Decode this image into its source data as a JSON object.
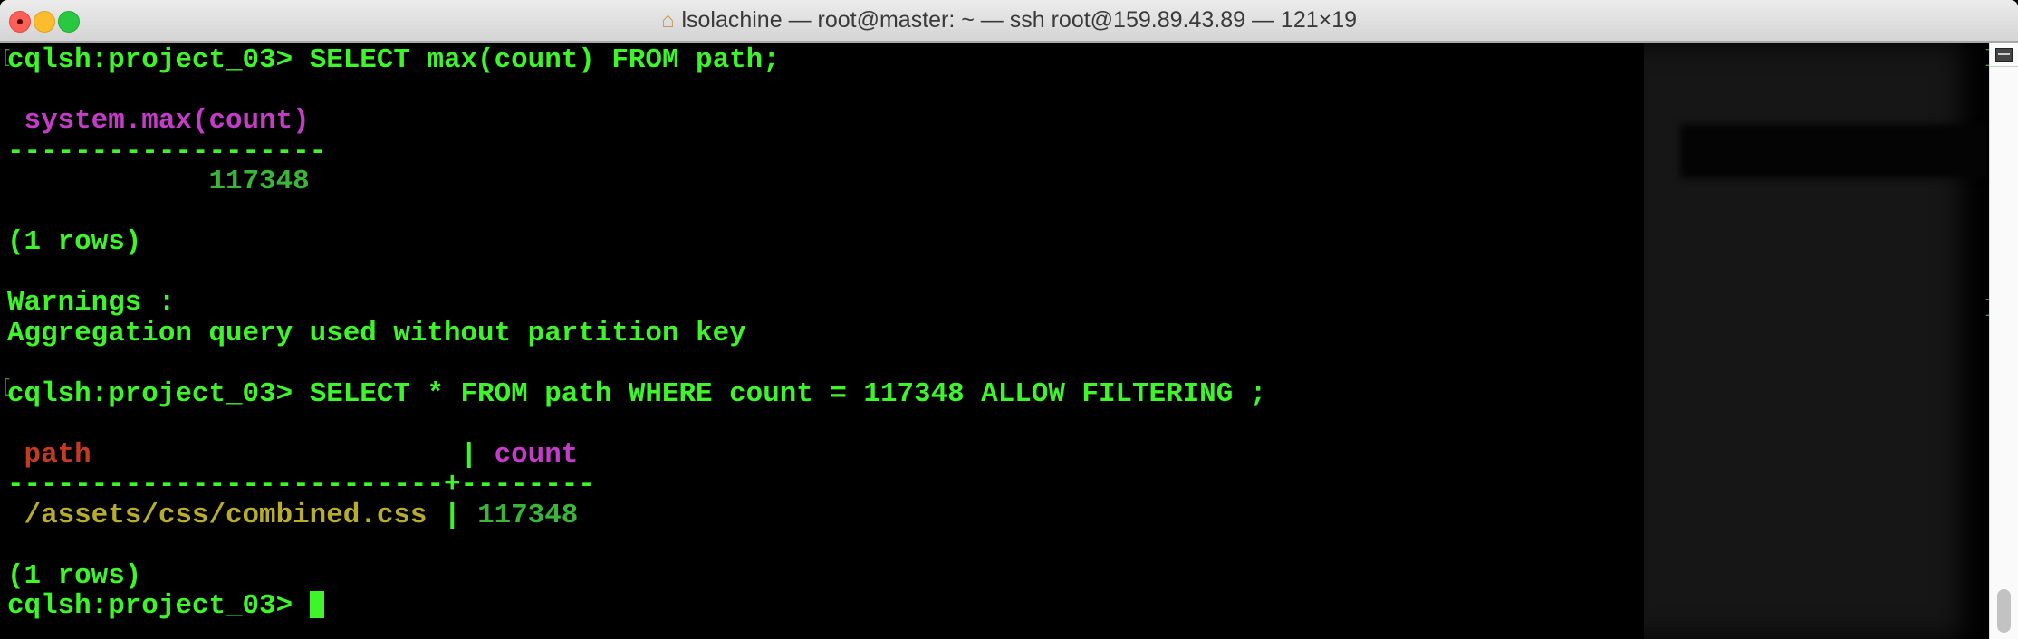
{
  "window": {
    "title": "lsolachine — root@master: ~ — ssh root@159.89.43.89 — 121×19"
  },
  "terminal": {
    "prompt": "cqlsh:project_03> ",
    "query1": "SELECT max(count) FROM path;",
    "result1": {
      "header": " system.max(count)",
      "separator": "-------------------",
      "value": "            117348",
      "rows": "(1 rows)"
    },
    "warnings_label": "Warnings :",
    "warning_text": "Aggregation query used without partition key",
    "query2": "SELECT * FROM path WHERE count = 117348 ALLOW FILTERING ;",
    "result2": {
      "columns": [
        " path",
        "count"
      ],
      "col_pad": "                     ",
      "pipe": " | ",
      "separator": "--------------------------+--------",
      "row": {
        "path": " /assets/css/combined.css",
        "count": "117348"
      },
      "rows": "(1 rows)"
    },
    "colors": {
      "prompt": "#3df52a",
      "column_key": "#c53a22",
      "column": "#c43cc8",
      "text_value": "#b7ad2a",
      "number_value": "#3bb43a"
    }
  }
}
